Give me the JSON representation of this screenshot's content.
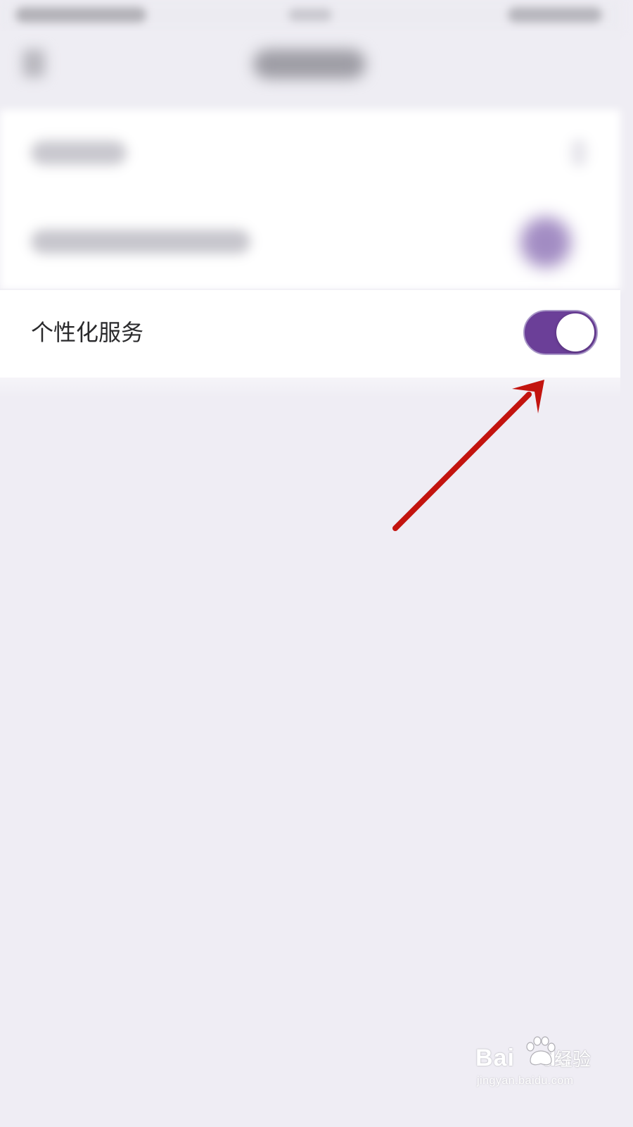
{
  "settings": {
    "personalized_service": {
      "label": "个性化服务",
      "enabled": true
    }
  },
  "colors": {
    "background": "#efedf4",
    "row_background": "#ffffff",
    "toggle_on": "#6b3f98",
    "annotation_arrow": "#c3140f"
  },
  "icons": {
    "annotation": "red-arrow-icon",
    "toggle": "toggle-switch-icon"
  },
  "watermark": {
    "logo_text": "Bai",
    "logo_text_tail": "du",
    "logo_suffix": "经验",
    "url": "jingyan.baidu.com"
  }
}
